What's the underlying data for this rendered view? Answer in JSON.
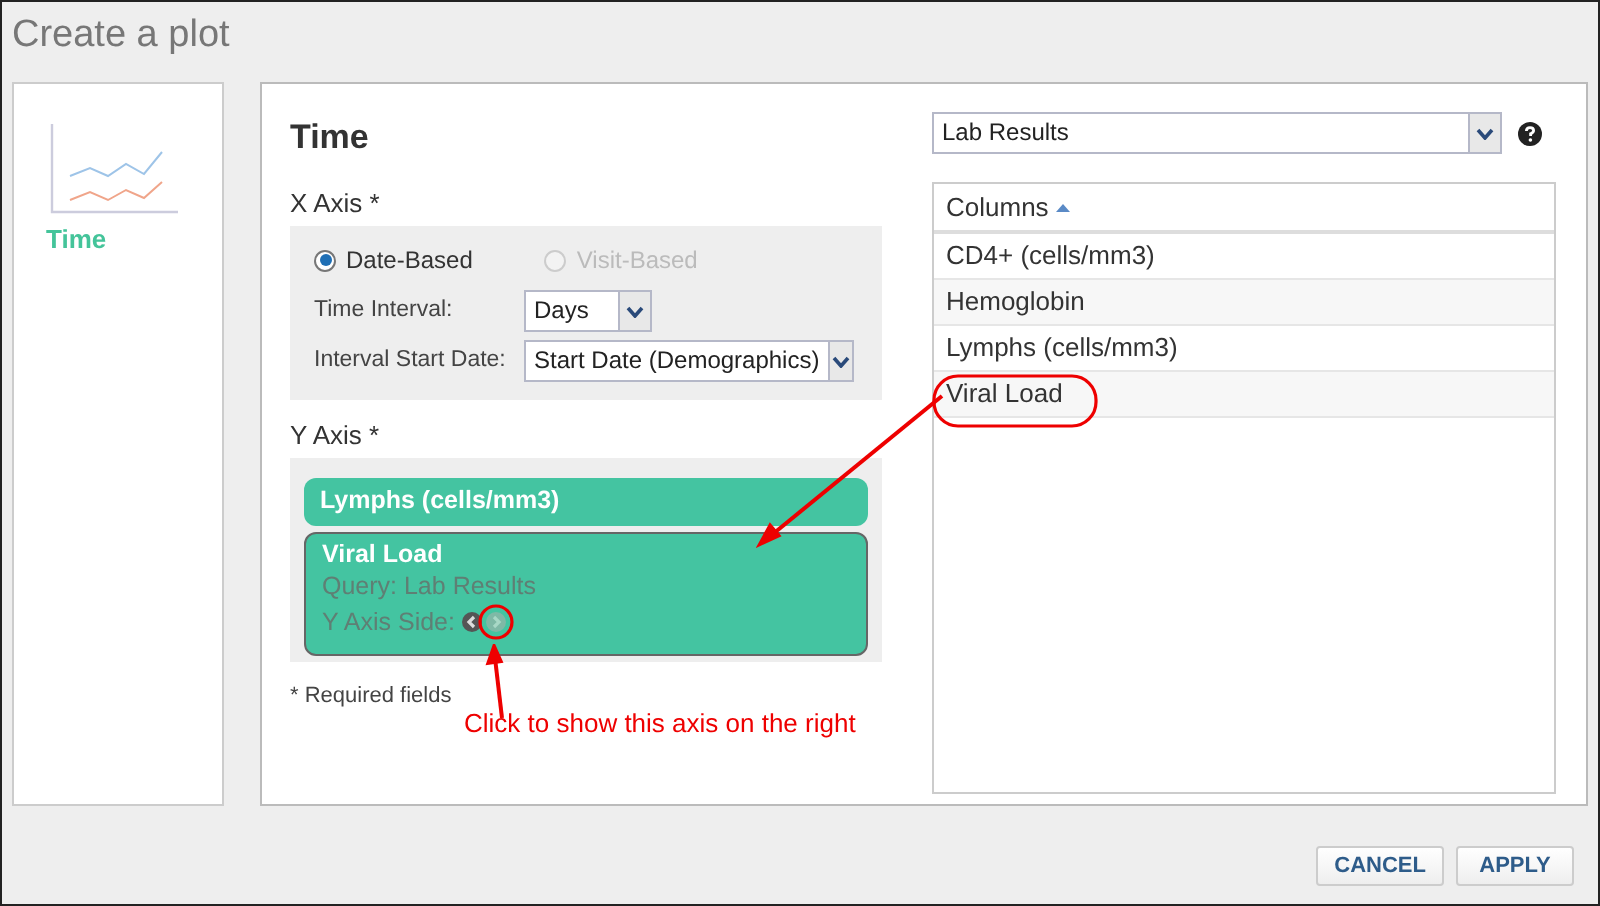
{
  "window": {
    "title": "Create a plot"
  },
  "sidebar": {
    "items": [
      {
        "label": "Time",
        "selected": true
      }
    ]
  },
  "panel": {
    "title": "Time",
    "x_axis": {
      "label": "X Axis *",
      "options": [
        {
          "label": "Date-Based",
          "selected": true,
          "disabled": false
        },
        {
          "label": "Visit-Based",
          "selected": false,
          "disabled": true
        }
      ],
      "fields": [
        {
          "label": "Time Interval:",
          "value": "Days"
        },
        {
          "label": "Interval Start Date:",
          "value": "Start Date (Demographics)"
        }
      ]
    },
    "y_axis": {
      "label": "Y Axis *",
      "measures": [
        {
          "name": "Lymphs (cells/mm3)",
          "expanded": false
        },
        {
          "name": "Viral Load",
          "expanded": true,
          "query": "Query: Lab Results",
          "side_label": "Y Axis Side:",
          "sides": [
            {
              "selected": true
            },
            {
              "selected": false
            }
          ]
        }
      ]
    },
    "note": "* Required fields",
    "query_select": {
      "value": "Lab Results"
    },
    "columns": {
      "header": "Columns",
      "rows": [
        {
          "label": "CD4+ (cells/mm3)"
        },
        {
          "label": "Hemoglobin"
        },
        {
          "label": "Lymphs (cells/mm3)"
        },
        {
          "label": "Viral Load"
        }
      ]
    }
  },
  "annotation": {
    "text": "Click to show this axis on the right"
  },
  "buttons": [
    "CANCEL",
    "APPLY"
  ]
}
